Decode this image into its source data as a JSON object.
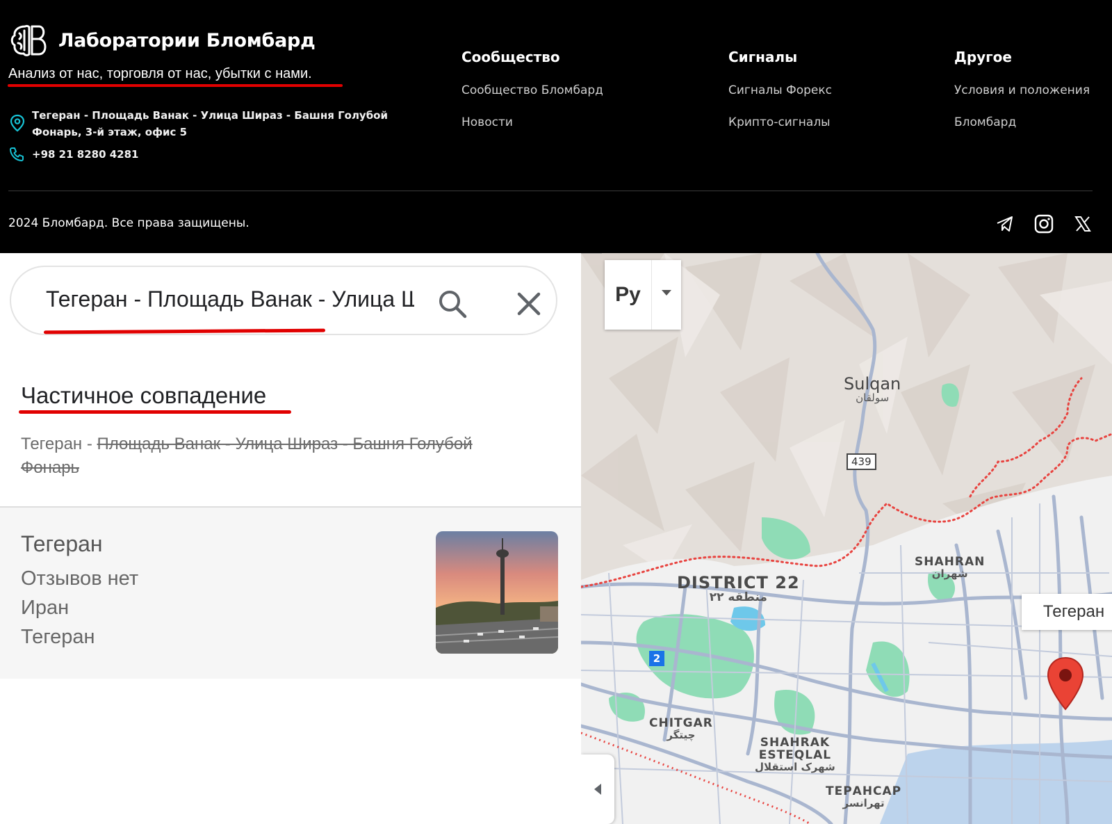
{
  "footer": {
    "brand_name": "Лаборатории Бломбард",
    "tagline": "Анализ от нас, торговля от нас, убытки с нами.",
    "address": "Тегеран - Площадь Ванак - Улица Шираз - Башня Голубой Фонарь, 3-й этаж, офис 5",
    "phone": "+98 21 8280 4281",
    "columns": [
      {
        "title": "Сообщество",
        "links": [
          "Сообщество Бломбард",
          "Новости"
        ]
      },
      {
        "title": "Сигналы",
        "links": [
          "Сигналы Форекс",
          "Крипто-сигналы"
        ]
      },
      {
        "title": "Другое",
        "links": [
          "Условия и положения",
          "Бломбард"
        ]
      }
    ],
    "copyright": "2024 Бломбард. Все права защищены.",
    "socials": [
      "telegram-icon",
      "instagram-icon",
      "x-icon"
    ],
    "accent": "#e10000"
  },
  "search": {
    "value": "Тегеран - Площадь Ванак - Улица Ш"
  },
  "partial_match": {
    "title": "Частичное совпадение",
    "kept": "Тегеран - ",
    "struck": "Площадь Ванак - Улица Шираз - Башня Голубой Фонарь"
  },
  "result": {
    "name": "Тегеран",
    "reviews": "Отзывов нет",
    "country": "Иран",
    "city": "Тегеран"
  },
  "map": {
    "type_button": "Ру",
    "labels": {
      "sulqan": "Sulqan",
      "sulqan_fa": "سولقان",
      "district22": "DISTRICT 22",
      "district22_fa": "منطقه ۲۲",
      "shahran": "SHAHRAN",
      "shahran_fa": "شهران",
      "chitgar": "CHITGAR",
      "chitgar_fa": "چیتگر",
      "shahrak1": "SHAHRAK",
      "shahrak2": "ESTEQLAL",
      "shahrak_fa": "شهرک استقلال",
      "tehransar": "ТЕРАНСАР",
      "tehransar_fa": "تهرانسر"
    },
    "road_439": "439",
    "route_2": "2",
    "place_label": "Тегеран",
    "pin_color": "#ea4335"
  }
}
